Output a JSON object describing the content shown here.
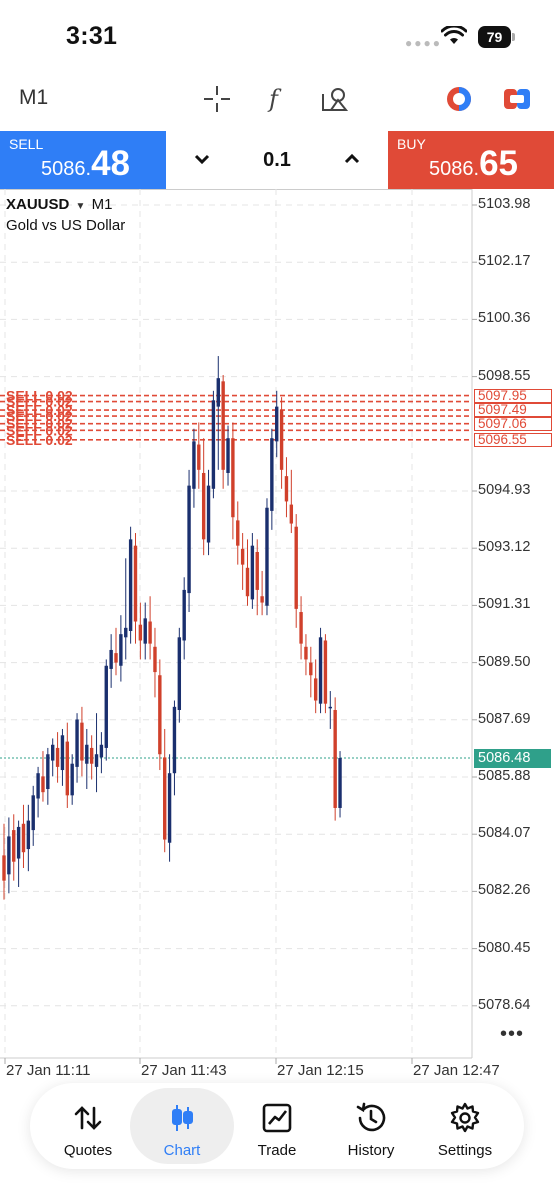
{
  "status_bar": {
    "time": "3:31",
    "battery": "79"
  },
  "toolbar": {
    "timeframe": "M1"
  },
  "trade": {
    "sell_label": "SELL",
    "sell_price_prefix": "5086.",
    "sell_price_big": "48",
    "buy_label": "BUY",
    "buy_price_prefix": "5086.",
    "buy_price_big": "65",
    "lot": "0.1"
  },
  "chart": {
    "symbol": "XAUUSD",
    "period": "M1",
    "description": "Gold vs US Dollar",
    "y_labels": [
      "5103.98",
      "5102.17",
      "5100.36",
      "5098.55",
      "5094.93",
      "5093.12",
      "5091.31",
      "5089.50",
      "5087.69",
      "5085.88",
      "5084.07",
      "5082.26",
      "5080.45",
      "5078.64"
    ],
    "x_labels": [
      "27 Jan 11:11",
      "27 Jan 11:43",
      "27 Jan 12:15",
      "27 Jan 12:47"
    ],
    "current_price": "5086.48",
    "order_labels": [
      "5097.95",
      "5097.49",
      "5097.06",
      "5096.55"
    ],
    "order_line_text": "SELL 0.02"
  },
  "chart_data": {
    "type": "candlestick",
    "symbol": "XAUUSD",
    "timeframe": "M1",
    "ylim": [
      5077.5,
      5105.0
    ],
    "current_price": 5086.48,
    "candles": [
      {
        "o": 5083.4,
        "h": 5084.4,
        "l": 5082.0,
        "c": 5082.6
      },
      {
        "o": 5082.8,
        "h": 5084.6,
        "l": 5082.2,
        "c": 5084.0
      },
      {
        "o": 5084.2,
        "h": 5084.7,
        "l": 5082.6,
        "c": 5083.2
      },
      {
        "o": 5083.3,
        "h": 5084.5,
        "l": 5082.4,
        "c": 5084.3
      },
      {
        "o": 5084.4,
        "h": 5085.0,
        "l": 5083.0,
        "c": 5083.5
      },
      {
        "o": 5083.6,
        "h": 5085.0,
        "l": 5082.9,
        "c": 5084.5
      },
      {
        "o": 5084.2,
        "h": 5085.6,
        "l": 5083.7,
        "c": 5085.3
      },
      {
        "o": 5085.2,
        "h": 5086.2,
        "l": 5084.6,
        "c": 5086.0
      },
      {
        "o": 5085.9,
        "h": 5086.7,
        "l": 5085.1,
        "c": 5085.4
      },
      {
        "o": 5085.5,
        "h": 5086.8,
        "l": 5085.0,
        "c": 5086.6
      },
      {
        "o": 5086.4,
        "h": 5087.1,
        "l": 5085.9,
        "c": 5086.9
      },
      {
        "o": 5086.8,
        "h": 5087.3,
        "l": 5085.7,
        "c": 5086.2
      },
      {
        "o": 5086.1,
        "h": 5087.4,
        "l": 5085.6,
        "c": 5087.2
      },
      {
        "o": 5087.0,
        "h": 5087.6,
        "l": 5084.9,
        "c": 5085.3
      },
      {
        "o": 5085.3,
        "h": 5086.6,
        "l": 5085.0,
        "c": 5086.3
      },
      {
        "o": 5086.2,
        "h": 5087.9,
        "l": 5085.7,
        "c": 5087.7
      },
      {
        "o": 5087.6,
        "h": 5088.1,
        "l": 5085.9,
        "c": 5086.4
      },
      {
        "o": 5086.3,
        "h": 5087.4,
        "l": 5085.5,
        "c": 5086.9
      },
      {
        "o": 5086.8,
        "h": 5087.2,
        "l": 5085.8,
        "c": 5086.3
      },
      {
        "o": 5086.2,
        "h": 5087.9,
        "l": 5085.4,
        "c": 5086.6
      },
      {
        "o": 5086.5,
        "h": 5087.3,
        "l": 5086.0,
        "c": 5086.9
      },
      {
        "o": 5086.8,
        "h": 5089.6,
        "l": 5086.4,
        "c": 5089.4
      },
      {
        "o": 5089.3,
        "h": 5090.4,
        "l": 5088.7,
        "c": 5089.9
      },
      {
        "o": 5089.8,
        "h": 5090.6,
        "l": 5089.1,
        "c": 5089.5
      },
      {
        "o": 5089.4,
        "h": 5091.0,
        "l": 5088.9,
        "c": 5090.4
      },
      {
        "o": 5090.3,
        "h": 5092.8,
        "l": 5089.6,
        "c": 5090.6
      },
      {
        "o": 5090.5,
        "h": 5093.8,
        "l": 5090.1,
        "c": 5093.4
      },
      {
        "o": 5093.2,
        "h": 5093.6,
        "l": 5090.1,
        "c": 5090.8
      },
      {
        "o": 5090.7,
        "h": 5091.4,
        "l": 5089.6,
        "c": 5090.2
      },
      {
        "o": 5090.1,
        "h": 5091.4,
        "l": 5089.6,
        "c": 5090.9
      },
      {
        "o": 5090.8,
        "h": 5091.6,
        "l": 5089.6,
        "c": 5090.1
      },
      {
        "o": 5090.0,
        "h": 5090.6,
        "l": 5088.4,
        "c": 5089.2
      },
      {
        "o": 5089.1,
        "h": 5089.6,
        "l": 5086.1,
        "c": 5086.6
      },
      {
        "o": 5086.5,
        "h": 5087.4,
        "l": 5083.5,
        "c": 5083.9
      },
      {
        "o": 5083.8,
        "h": 5086.6,
        "l": 5083.2,
        "c": 5086.0
      },
      {
        "o": 5086.0,
        "h": 5088.3,
        "l": 5085.3,
        "c": 5088.1
      },
      {
        "o": 5088.0,
        "h": 5090.6,
        "l": 5087.6,
        "c": 5090.3
      },
      {
        "o": 5090.2,
        "h": 5092.2,
        "l": 5089.6,
        "c": 5091.8
      },
      {
        "o": 5091.7,
        "h": 5095.6,
        "l": 5091.1,
        "c": 5095.1
      },
      {
        "o": 5095.0,
        "h": 5096.9,
        "l": 5094.4,
        "c": 5096.5
      },
      {
        "o": 5096.4,
        "h": 5097.1,
        "l": 5095.0,
        "c": 5095.6
      },
      {
        "o": 5095.5,
        "h": 5096.6,
        "l": 5092.9,
        "c": 5093.4
      },
      {
        "o": 5093.3,
        "h": 5095.6,
        "l": 5092.9,
        "c": 5095.1
      },
      {
        "o": 5095.0,
        "h": 5098.1,
        "l": 5094.7,
        "c": 5097.8
      },
      {
        "o": 5097.6,
        "h": 5099.2,
        "l": 5095.6,
        "c": 5098.5
      },
      {
        "o": 5098.4,
        "h": 5098.6,
        "l": 5095.0,
        "c": 5095.6
      },
      {
        "o": 5095.5,
        "h": 5097.0,
        "l": 5095.1,
        "c": 5096.6
      },
      {
        "o": 5096.6,
        "h": 5097.1,
        "l": 5093.4,
        "c": 5094.1
      },
      {
        "o": 5094.0,
        "h": 5094.6,
        "l": 5092.6,
        "c": 5093.2
      },
      {
        "o": 5093.1,
        "h": 5093.6,
        "l": 5091.8,
        "c": 5092.6
      },
      {
        "o": 5092.5,
        "h": 5093.4,
        "l": 5091.3,
        "c": 5091.6
      },
      {
        "o": 5091.5,
        "h": 5093.6,
        "l": 5091.2,
        "c": 5093.2
      },
      {
        "o": 5093.0,
        "h": 5093.4,
        "l": 5091.0,
        "c": 5091.8
      },
      {
        "o": 5091.6,
        "h": 5092.4,
        "l": 5091.0,
        "c": 5091.4
      },
      {
        "o": 5091.3,
        "h": 5094.7,
        "l": 5091.0,
        "c": 5094.4
      },
      {
        "o": 5094.3,
        "h": 5096.9,
        "l": 5093.7,
        "c": 5096.6
      },
      {
        "o": 5096.5,
        "h": 5098.1,
        "l": 5096.0,
        "c": 5097.6
      },
      {
        "o": 5097.5,
        "h": 5097.9,
        "l": 5095.0,
        "c": 5095.6
      },
      {
        "o": 5095.4,
        "h": 5096.0,
        "l": 5094.1,
        "c": 5094.6
      },
      {
        "o": 5094.5,
        "h": 5095.6,
        "l": 5093.6,
        "c": 5093.9
      },
      {
        "o": 5093.8,
        "h": 5094.2,
        "l": 5090.6,
        "c": 5091.2
      },
      {
        "o": 5091.1,
        "h": 5091.6,
        "l": 5089.6,
        "c": 5090.1
      },
      {
        "o": 5090.0,
        "h": 5090.4,
        "l": 5089.1,
        "c": 5089.6
      },
      {
        "o": 5089.5,
        "h": 5090.0,
        "l": 5088.4,
        "c": 5089.1
      },
      {
        "o": 5089.0,
        "h": 5089.6,
        "l": 5087.9,
        "c": 5088.3
      },
      {
        "o": 5088.2,
        "h": 5090.6,
        "l": 5087.9,
        "c": 5090.3
      },
      {
        "o": 5090.2,
        "h": 5090.4,
        "l": 5087.9,
        "c": 5088.2
      },
      {
        "o": 5088.1,
        "h": 5088.6,
        "l": 5087.4,
        "c": 5088.1
      },
      {
        "o": 5088.0,
        "h": 5088.4,
        "l": 5084.5,
        "c": 5084.9
      },
      {
        "o": 5084.9,
        "h": 5086.7,
        "l": 5084.6,
        "c": 5086.48
      }
    ]
  },
  "nav": {
    "items": [
      {
        "label": "Quotes"
      },
      {
        "label": "Chart"
      },
      {
        "label": "Trade"
      },
      {
        "label": "History"
      },
      {
        "label": "Settings"
      }
    ]
  },
  "colors": {
    "sell": "#2f7ef6",
    "buy": "#e04a37",
    "bull": "#1a2f6e",
    "bear": "#d0402b",
    "current": "#2fa08a"
  }
}
